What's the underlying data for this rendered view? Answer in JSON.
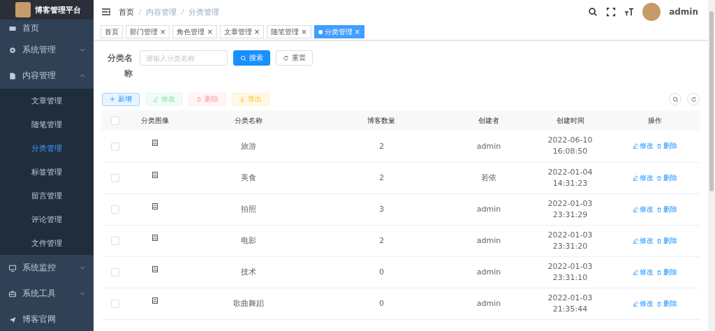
{
  "sidebar": {
    "title": "博客管理平台",
    "items": [
      {
        "label": "首页"
      },
      {
        "label": "系统管理",
        "expanded": false
      },
      {
        "label": "内容管理",
        "expanded": true,
        "children": [
          {
            "label": "文章管理",
            "selected": false
          },
          {
            "label": "随笔管理",
            "selected": false
          },
          {
            "label": "分类管理",
            "selected": true
          },
          {
            "label": "标签管理",
            "selected": false
          },
          {
            "label": "留言管理",
            "selected": false
          },
          {
            "label": "评论管理",
            "selected": false
          },
          {
            "label": "文件管理",
            "selected": false
          }
        ]
      },
      {
        "label": "系统监控",
        "expanded": false
      },
      {
        "label": "系统工具",
        "expanded": false
      },
      {
        "label": "博客官网"
      }
    ]
  },
  "navbar": {
    "breadcrumb": [
      "首页",
      "内容管理",
      "分类管理"
    ],
    "user": "admin"
  },
  "tabs": [
    {
      "label": "首页",
      "selected": false
    },
    {
      "label": "部门管理",
      "close": "×",
      "selected": false
    },
    {
      "label": "角色管理",
      "close": "×",
      "selected": false
    },
    {
      "label": "文章管理",
      "close": "×",
      "selected": false
    },
    {
      "label": "随笔管理",
      "close": "×",
      "selected": false
    },
    {
      "label": "分类管理",
      "close": "×",
      "selected": true
    }
  ],
  "search": {
    "label": "分类名称",
    "placeholder": "请输入分类名称",
    "search_button": "搜索",
    "reset_button": "重置"
  },
  "toolbar": [
    {
      "label": "新增",
      "kind": "add",
      "disabled": false
    },
    {
      "label": "修改",
      "kind": "edit",
      "disabled": true
    },
    {
      "label": "删除",
      "kind": "delete",
      "disabled": true
    },
    {
      "label": "导出",
      "kind": "export",
      "disabled": false
    }
  ],
  "table": {
    "select_all_checked": false,
    "columns": [
      "分类图像",
      "分类名称",
      "博客数量",
      "创建者",
      "创建时间",
      "操作"
    ],
    "rows": [
      {
        "checked": false,
        "name": "旅游",
        "count": "2",
        "creator": "admin",
        "created": "2022-06-10 16:08:50",
        "actions": [
          "修改",
          "删除"
        ]
      },
      {
        "checked": false,
        "name": "美食",
        "count": "2",
        "creator": "若依",
        "created": "2022-01-04 14:31:23",
        "actions": [
          "修改",
          "删除"
        ]
      },
      {
        "checked": false,
        "name": "拍照",
        "count": "3",
        "creator": "admin",
        "created": "2022-01-03 23:31:29",
        "actions": [
          "修改",
          "删除"
        ]
      },
      {
        "checked": false,
        "name": "电影",
        "count": "2",
        "creator": "admin",
        "created": "2022-01-03 23:31:20",
        "actions": [
          "修改",
          "删除"
        ]
      },
      {
        "checked": false,
        "name": "技术",
        "count": "0",
        "creator": "admin",
        "created": "2022-01-03 23:31:10",
        "actions": [
          "修改",
          "删除"
        ]
      },
      {
        "checked": false,
        "name": "歌曲舞蹈",
        "count": "0",
        "creator": "admin",
        "created": "2022-01-03 21:35:44",
        "actions": [
          "修改",
          "删除"
        ]
      }
    ]
  }
}
